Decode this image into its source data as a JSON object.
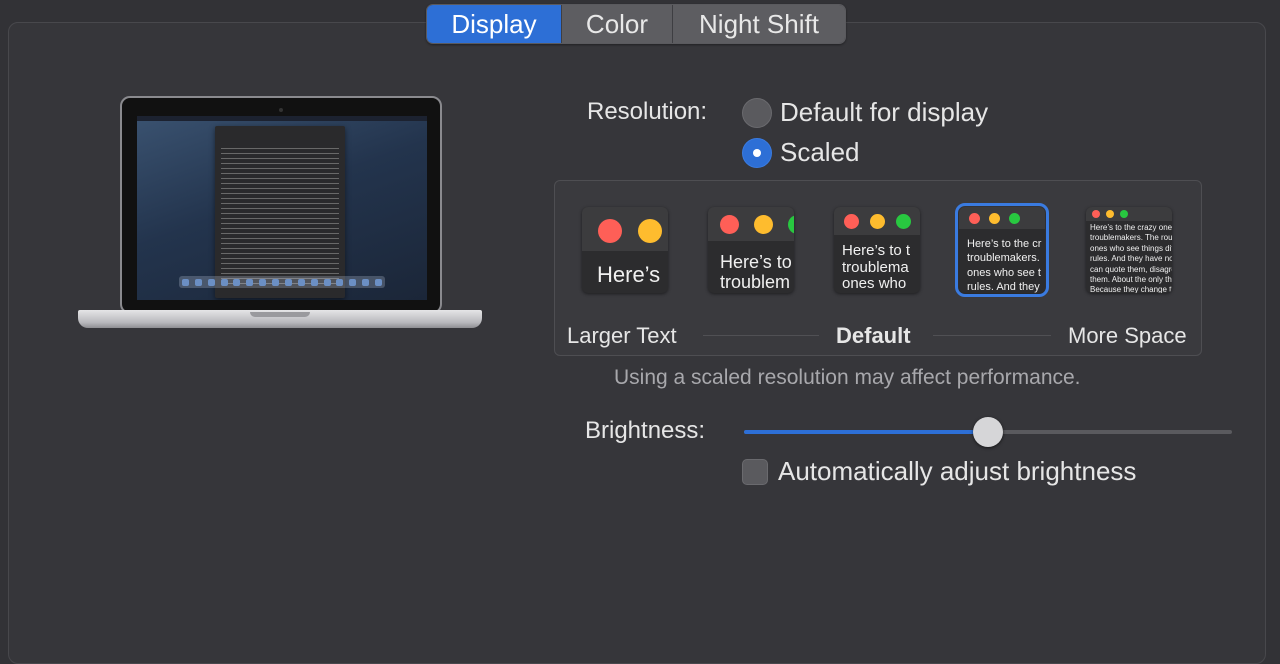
{
  "tabs": [
    {
      "label": "Display",
      "active": true
    },
    {
      "label": "Color",
      "active": false
    },
    {
      "label": "Night Shift",
      "active": false
    }
  ],
  "resolution": {
    "label": "Resolution:",
    "options": [
      {
        "label": "Default for display",
        "selected": false
      },
      {
        "label": "Scaled",
        "selected": true
      }
    ]
  },
  "scaled": {
    "options": [
      {
        "preview_text": "Here’s"
      },
      {
        "preview_text": "Here’s to\ntroublem"
      },
      {
        "preview_text": "Here’s to t\ntroublema\nones who"
      },
      {
        "preview_text": "Here’s to the cr\ntroublemakers.\nones who see t\nrules. And they",
        "selected": true
      },
      {
        "preview_text": "Here’s to the crazy one\ntroublemakers. The rou\nones who see things dif\nrules. And they have no\ncan quote them, disagre\nthem. About the only th\nBecause they change th"
      }
    ],
    "label_left": "Larger Text",
    "label_center": "Default",
    "label_right": "More Space"
  },
  "note": "Using a scaled resolution may affect performance.",
  "brightness": {
    "label": "Brightness:",
    "value": 0.5
  },
  "auto_brightness": {
    "label": "Automatically adjust brightness",
    "checked": false
  },
  "colors": {
    "accent": "#2d6fd6",
    "close": "#fe5f57",
    "minimize": "#febc2e",
    "zoom": "#28c840"
  }
}
